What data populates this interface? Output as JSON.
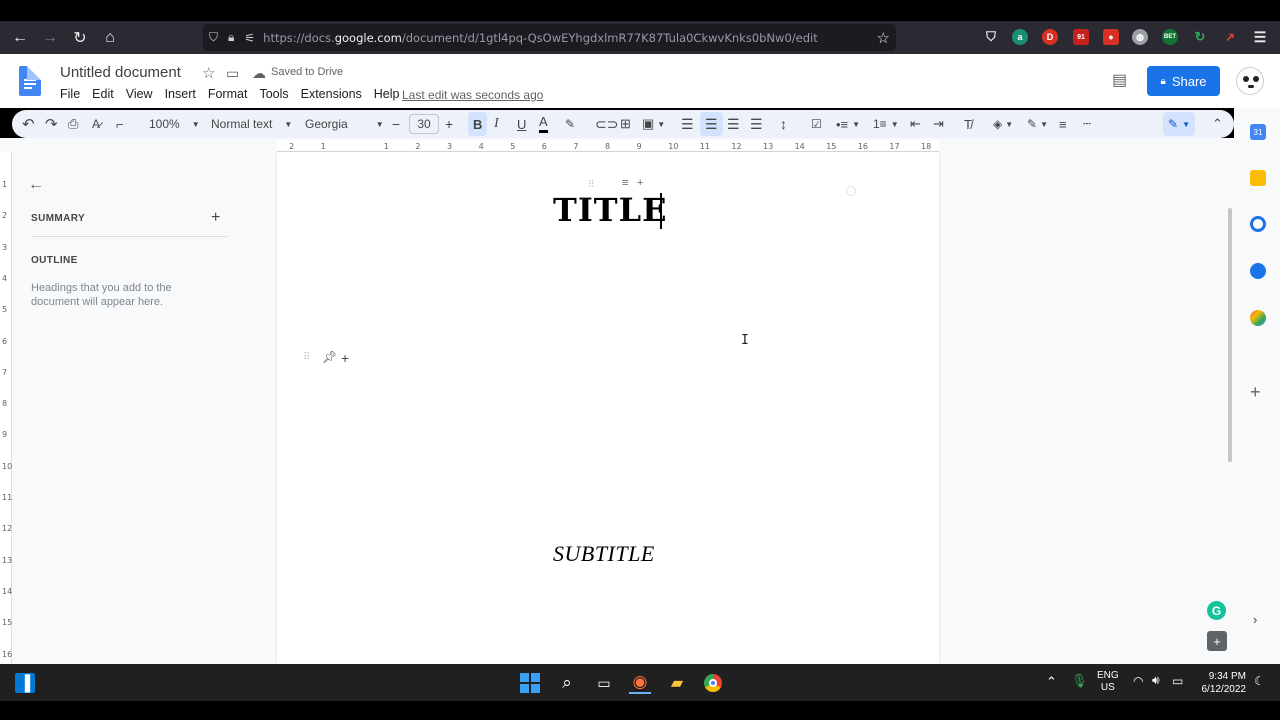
{
  "browser": {
    "url_prefix": "https://docs.",
    "url_domain": "google.com",
    "url_rest": "/document/d/1gtl4pq-QsOwEYhgdxlmR77K87Tula0CkwvKnks0bNw0/edit",
    "ext_badge_91": "91",
    "ext_bet": "BET"
  },
  "docs": {
    "title": "Untitled document",
    "saved_status": "Saved to Drive",
    "menu": [
      "File",
      "Edit",
      "View",
      "Insert",
      "Format",
      "Tools",
      "Extensions",
      "Help"
    ],
    "last_edit": "Last edit was seconds ago",
    "share_label": "Share"
  },
  "toolbar": {
    "zoom": "100%",
    "style": "Normal text",
    "font": "Georgia",
    "font_size": "30"
  },
  "outline": {
    "summary_label": "SUMMARY",
    "outline_label": "OUTLINE",
    "hint": "Headings that you add to the document will appear here."
  },
  "document": {
    "title_text": "TITLE",
    "subtitle_text": "SUBTITLE"
  },
  "taskbar": {
    "lang_1": "ENG",
    "lang_2": "US",
    "time": "9:34 PM",
    "date": "6/12/2022"
  },
  "colors": {
    "accent": "#1a73e8",
    "grammarly": "#15c39a"
  }
}
